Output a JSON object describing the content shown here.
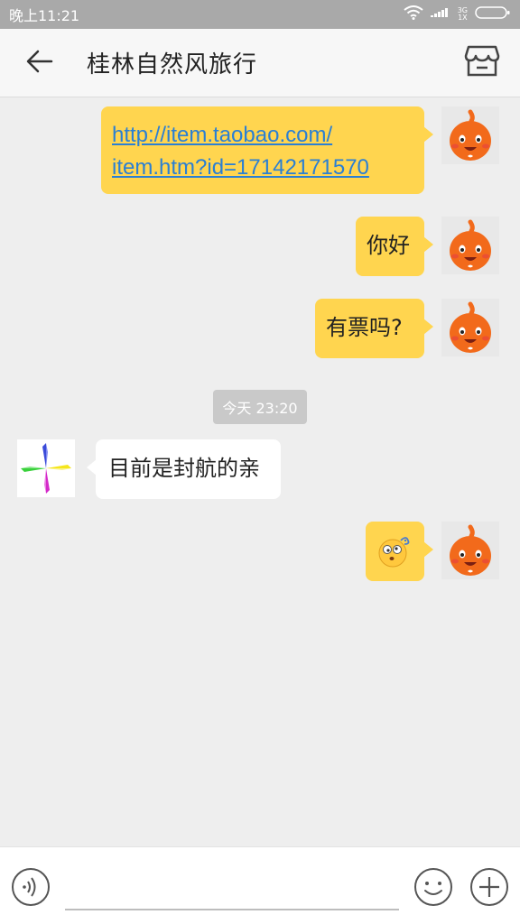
{
  "status_bar": {
    "time": "晚上11:21",
    "network_top": "3G",
    "network_bottom": "1X",
    "icons": [
      "wifi-icon",
      "signal-icon",
      "battery-icon"
    ]
  },
  "header": {
    "title": "桂林自然风旅行",
    "back_icon": "arrow-left-icon",
    "shop_icon": "shop-icon"
  },
  "messages": [
    {
      "direction": "out",
      "type": "link",
      "lines": [
        "http://item.taobao.com/",
        "item.htm?id=17142171570"
      ]
    },
    {
      "direction": "out",
      "type": "text",
      "text": "你好"
    },
    {
      "direction": "out",
      "type": "text",
      "text": "有票吗?"
    },
    {
      "type": "timestamp",
      "text": "今天 23:20"
    },
    {
      "direction": "in",
      "type": "text",
      "text": "目前是封航的亲"
    },
    {
      "direction": "out",
      "type": "emoji",
      "emoji": "dizzy-face-emoji"
    }
  ],
  "input_bar": {
    "placeholder": "",
    "voice_icon": "voice-icon",
    "emoji_icon": "smiley-icon",
    "plus_icon": "plus-circle-icon"
  },
  "colors": {
    "status_bar": "#a9a9a9",
    "header_bg": "#f7f7f7",
    "chat_bg": "#eeeeee",
    "outgoing_bubble": "#ffd54f",
    "incoming_bubble": "#ffffff",
    "link": "#2a7fd4",
    "avatar_orange": "#f26a1b"
  }
}
